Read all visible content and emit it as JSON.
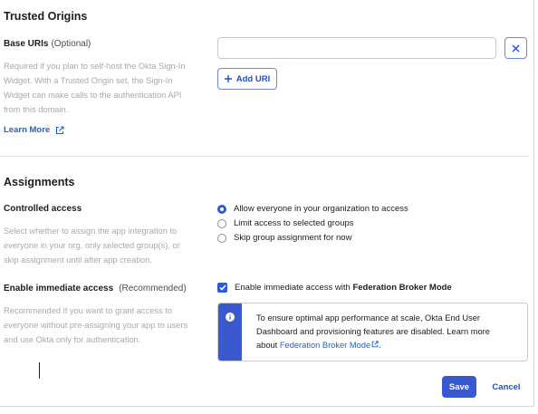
{
  "trusted_origins": {
    "heading": "Trusted Origins",
    "base_uris_label": "Base URIs",
    "base_uris_optional": "(Optional)",
    "help_lines": [
      "Required if you plan to self-host the Okta Sign-In",
      "Widget. With a Trusted Origin set, the Sign-In",
      "Widget can make calls to the authentication API",
      "from this domain."
    ],
    "learn_more": "Learn More",
    "uri_value": "",
    "add_uri": "Add URI"
  },
  "assignments": {
    "heading": "Assignments",
    "controlled_access_label": "Controlled access",
    "controlled_help_lines": [
      "Select whether to assign the app integration to",
      "everyone in your org, only selected group(s), or",
      "skip assignment until after app creation."
    ],
    "options": [
      {
        "label": "Allow everyone in your organization to access",
        "selected": true
      },
      {
        "label": "Limit access to selected groups",
        "selected": false
      },
      {
        "label": "Skip group assignment for now",
        "selected": false
      }
    ],
    "immediate_label": "Enable immediate access",
    "immediate_recommended": "(Recommended)",
    "immediate_help_lines": [
      "Recommended if you want to grant access to",
      "everyone without pre-assigning your app to users",
      "and use Okta only for authentication."
    ],
    "checkbox_prefix": "Enable immediate access with",
    "checkbox_bold": "Federation Broker Mode",
    "checkbox_checked": true,
    "callout_line1": "To ensure optimal app performance at scale, Okta End User",
    "callout_line2": "Dashboard and provisioning features are disabled. Learn more",
    "callout_line3_prefix": "about",
    "callout_link": "Federation Broker Mode",
    "callout_line3_suffix": "."
  },
  "footer": {
    "save": "Save",
    "cancel": "Cancel"
  },
  "colors": {
    "primary": "#3b59cf",
    "link": "#1662dd",
    "help_text": "#a8a8b0"
  }
}
